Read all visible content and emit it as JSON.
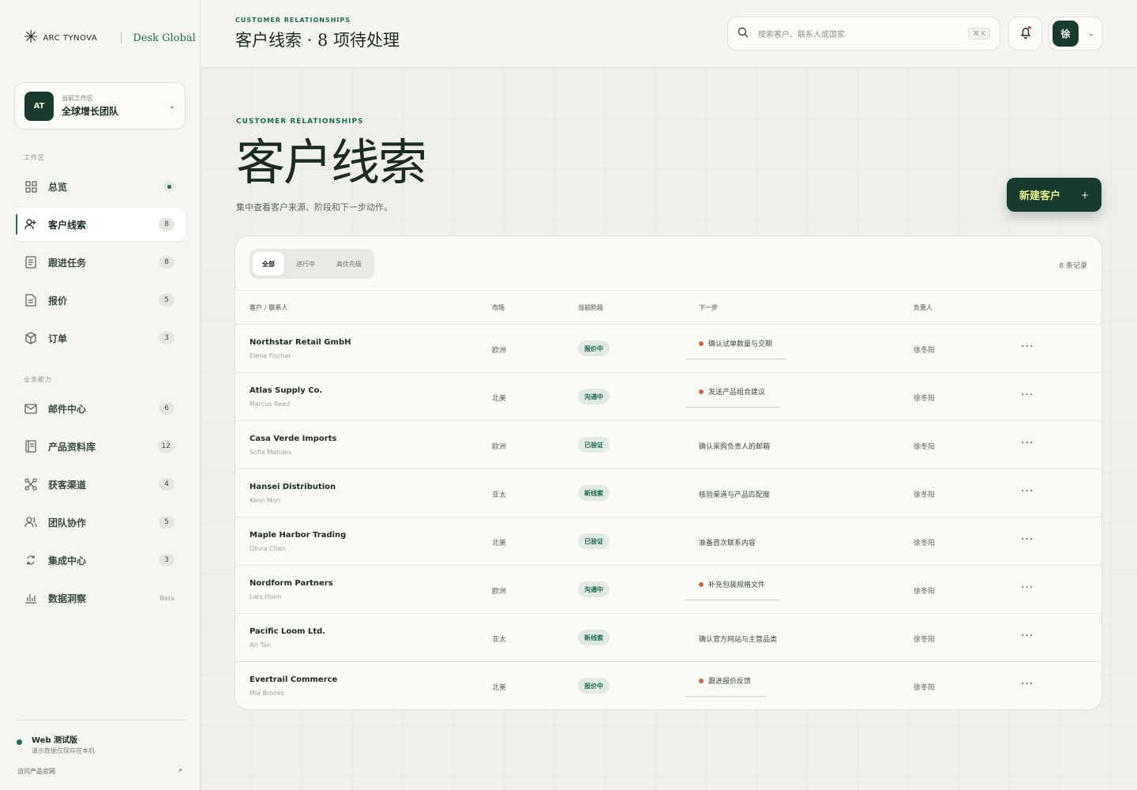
{
  "brand": {
    "name": "ARC TYNOVA",
    "product": "Desk Global"
  },
  "workspace": {
    "initials": "AT",
    "label": "当前工作区",
    "name": "全球增长团队"
  },
  "sidebar": {
    "group1_title": "工作区",
    "group2_title": "业务能力",
    "items": [
      {
        "label": "总览",
        "badge": ""
      },
      {
        "label": "客户线索",
        "badge": "8"
      },
      {
        "label": "跟进任务",
        "badge": "8"
      },
      {
        "label": "报价",
        "badge": "5"
      },
      {
        "label": "订单",
        "badge": "3"
      },
      {
        "label": "邮件中心",
        "badge": "6"
      },
      {
        "label": "产品资料库",
        "badge": "12"
      },
      {
        "label": "获客渠道",
        "badge": "4"
      },
      {
        "label": "团队协作",
        "badge": "5"
      },
      {
        "label": "集成中心",
        "badge": "3"
      },
      {
        "label": "数据洞察",
        "badge": "Beta"
      }
    ],
    "footer": {
      "title": "Web 测试版",
      "subtitle": "演示数据仅保存在本机",
      "visit": "访问产品官网",
      "visit_arrow": "↗"
    }
  },
  "topbar": {
    "eyebrow": "CUSTOMER RELATIONSHIPS",
    "title": "客户线索 · 8 项待处理",
    "search_placeholder": "搜索客户、联系人或国家",
    "shortcut": "⌘ K",
    "user_initial": "徐"
  },
  "hero": {
    "eyebrow": "CUSTOMER RELATIONSHIPS",
    "title": "客户线索",
    "subtitle": "集中查看客户来源、阶段和下一步动作。",
    "new_button": "新建客户",
    "new_plus": "+"
  },
  "table": {
    "tabs": [
      "全部",
      "进行中",
      "高优先级"
    ],
    "record_count": "8 条记录",
    "columns": [
      "客户 / 联系人",
      "市场",
      "当前阶段",
      "下一步",
      "负责人"
    ],
    "rows": [
      {
        "name": "Northstar Retail GmbH",
        "contact": "Elena Fischer",
        "market": "欧洲",
        "stage": "报价中",
        "next": "确认试单数量与交期",
        "highlight": true,
        "owner": "徐冬阳"
      },
      {
        "name": "Atlas Supply Co.",
        "contact": "Marcus Reed",
        "market": "北美",
        "stage": "沟通中",
        "next": "发送产品组合建议",
        "highlight": true,
        "owner": "徐冬阳"
      },
      {
        "name": "Casa Verde Imports",
        "contact": "Sofia Mendes",
        "market": "欧洲",
        "stage": "已验证",
        "next": "确认采购负责人的邮箱",
        "highlight": false,
        "owner": "徐冬阳"
      },
      {
        "name": "Hansei Distribution",
        "contact": "Kenji Mori",
        "market": "亚太",
        "stage": "新线索",
        "next": "核验渠道与产品匹配度",
        "highlight": false,
        "owner": "徐冬阳"
      },
      {
        "name": "Maple Harbor Trading",
        "contact": "Olivia Chen",
        "market": "北美",
        "stage": "已验证",
        "next": "准备首次联系内容",
        "highlight": false,
        "owner": "徐冬阳"
      },
      {
        "name": "Nordform Partners",
        "contact": "Lars Holm",
        "market": "欧洲",
        "stage": "沟通中",
        "next": "补充包装规格文件",
        "highlight": true,
        "owner": "徐冬阳"
      },
      {
        "name": "Pacific Loom Ltd.",
        "contact": "Ari Tan",
        "market": "亚太",
        "stage": "新线索",
        "next": "确认官方网站与主营品类",
        "highlight": false,
        "owner": "徐冬阳"
      },
      {
        "name": "Evertrail Commerce",
        "contact": "Mia Brooks",
        "market": "北美",
        "stage": "报价中",
        "next": "跟进报价反馈",
        "highlight": true,
        "owner": "徐冬阳"
      }
    ],
    "more_glyph": "···"
  },
  "colors": {
    "accent": "#1d6b55",
    "dark": "#183a2f",
    "cta_text": "#e6f28f",
    "dot": "#c9673e"
  }
}
